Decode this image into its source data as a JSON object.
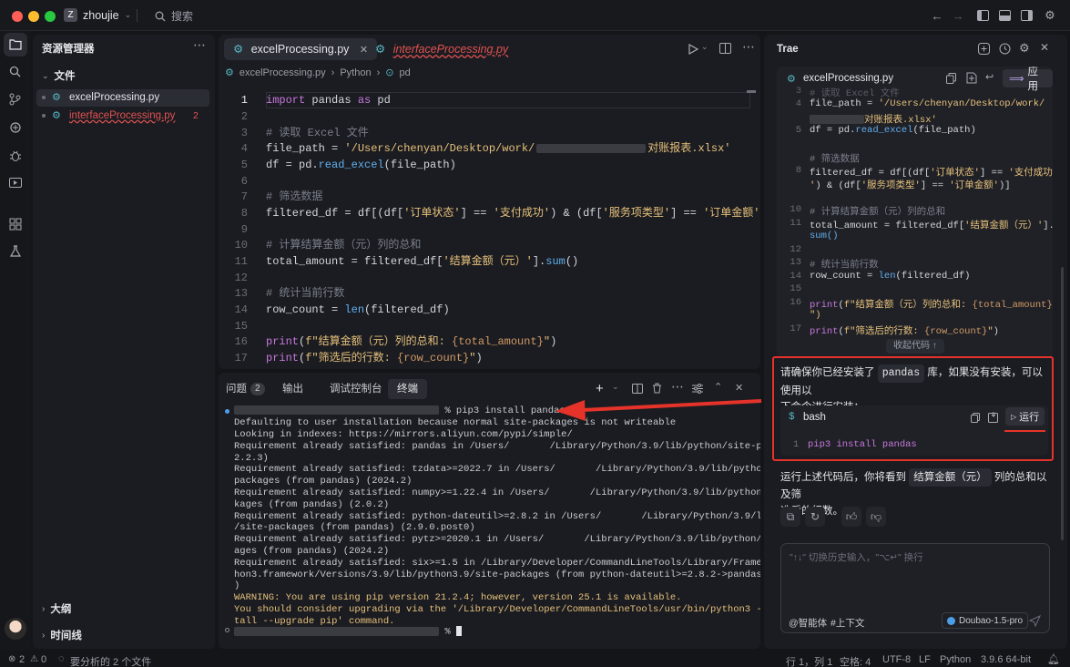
{
  "titlebar": {
    "workspace_initial": "Z",
    "workspace": "zhoujie",
    "search": "搜索"
  },
  "explorer": {
    "title": "资源管理器",
    "section": "文件",
    "files": [
      {
        "name": "excelProcessing.py",
        "badge": ""
      },
      {
        "name": "interfaceProcessing.py",
        "badge": "2"
      }
    ],
    "outline": "大纲",
    "timeline": "时间线"
  },
  "editor": {
    "tabs": [
      "excelProcessing.py",
      "interfaceProcessing.py"
    ],
    "breadcrumb": [
      "excelProcessing.py",
      "Python",
      "pd"
    ],
    "lines": [
      {
        "n": "1",
        "t": "import pandas as pd"
      },
      {
        "n": "2",
        "t": ""
      },
      {
        "n": "3",
        "t": "# 读取 Excel 文件"
      },
      {
        "n": "4",
        "t": "file_path = '/Users/chenyan/Desktop/work/"
      },
      {
        "n": "5",
        "t": "df = pd.read_excel(file_path)"
      },
      {
        "n": "6",
        "t": ""
      },
      {
        "n": "7",
        "t": "# 筛选数据"
      },
      {
        "n": "8",
        "t": "filtered_df = df[(df['订单状态'] == '支付成功') & (df['服务项类型'] == '订单金额')]"
      },
      {
        "n": "9",
        "t": ""
      },
      {
        "n": "10",
        "t": "# 计算结算金额（元）列的总和"
      },
      {
        "n": "11",
        "t": "total_amount = filtered_df['结算金额（元）'].sum()"
      },
      {
        "n": "12",
        "t": ""
      },
      {
        "n": "13",
        "t": "# 统计当前行数"
      },
      {
        "n": "14",
        "t": "row_count = len(filtered_df)"
      },
      {
        "n": "15",
        "t": ""
      },
      {
        "n": "16",
        "t": "print(f\"结算金额（元）列的总和: {total_amount}\")"
      },
      {
        "n": "17",
        "t": "print(f\"筛选后的行数: {row_count}\")"
      }
    ],
    "line4_tail": "对账报表.xlsx'"
  },
  "panel": {
    "tabs": [
      "问题",
      "输出",
      "调试控制台",
      "终端"
    ],
    "problems_count": "2",
    "command": "% pip3 install pandas",
    "output": [
      "Defaulting to user installation because normal site-packages is not writeable",
      "Looking in indexes: https://mirrors.aliyun.com/pypi/simple/",
      "Requirement already satisfied: pandas in /Users/       /Library/Python/3.9/lib/python/site-packages (",
      "2.2.3)",
      "Requirement already satisfied: tzdata>=2022.7 in /Users/       /Library/Python/3.9/lib/python/site-",
      "packages (from pandas) (2024.2)",
      "Requirement already satisfied: numpy>=1.22.4 in /Users/       /Library/Python/3.9/lib/python/site-pac",
      "kages (from pandas) (2.0.2)",
      "Requirement already satisfied: python-dateutil>=2.8.2 in /Users/       /Library/Python/3.9/lib/python3",
      "/site-packages (from pandas) (2.9.0.post0)",
      "Requirement already satisfied: pytz>=2020.1 in /Users/       /Library/Python/3.9/lib/python/site-pack",
      "ages (from pandas) (2024.2)",
      "Requirement already satisfied: six>=1.5 in /Library/Developer/CommandLineTools/Library/Frameworks/Pyt",
      "hon3.framework/Versions/3.9/lib/python3.9/site-packages (from python-dateutil>=2.8.2->pandas) (1.15.0",
      ")"
    ],
    "warnings": [
      "WARNING: You are using pip version 21.2.4; however, version 25.1 is available.",
      "You should consider upgrading via the '/Library/Developer/CommandLineTools/usr/bin/python3 -m pip ins",
      "tall --upgrade pip' command."
    ],
    "prompt_end": "%"
  },
  "trae": {
    "title": "Trae",
    "file": "excelProcessing.py",
    "apply": "应用",
    "code": [
      {
        "n": "3",
        "t": "# 读取 Excel 文件"
      },
      {
        "n": "4",
        "t": "file_path = '/Users/chenyan/Desktop/work/"
      },
      {
        "n": "",
        "t": "对账报表.xlsx'"
      },
      {
        "n": "5",
        "t": "df = pd.read_excel(file_path)"
      },
      {
        "n": "",
        "t": ""
      },
      {
        "n": "",
        "t": "# 筛选数据"
      },
      {
        "n": "8",
        "t": "filtered_df = df[(df['订单状态'] == '支付成功"
      },
      {
        "n": "",
        "t": "') & (df['服务项类型'] == '订单金额')]"
      },
      {
        "n": "",
        "t": ""
      },
      {
        "n": "10",
        "t": "# 计算结算金额（元）列的总和"
      },
      {
        "n": "11",
        "t": "total_amount = filtered_df['结算金额（元）']."
      },
      {
        "n": "",
        "t": "sum()"
      },
      {
        "n": "12",
        "t": ""
      },
      {
        "n": "13",
        "t": "# 统计当前行数"
      },
      {
        "n": "14",
        "t": "row_count = len(filtered_df)"
      },
      {
        "n": "15",
        "t": ""
      },
      {
        "n": "16",
        "t": "print(f\"结算金额（元）列的总和: {total_amount}"
      },
      {
        "n": "",
        "t": "\")"
      },
      {
        "n": "17",
        "t": "print(f\"筛选后的行数: {row_count}\")"
      }
    ],
    "collapse": "收起代码 ↑",
    "msg1_a": "请确保你已经安装了",
    "msg1_chip": "pandas",
    "msg1_b": "库，如果没有安装，可以使用以",
    "msg1_c": "下命令进行安装：",
    "bash_label": "bash",
    "run": "运行",
    "bash_line_no": "1",
    "bash_cmd": "pip3 install pandas",
    "msg2_a": "运行上述代码后，你将看到",
    "msg2_chip": "结算金额（元）",
    "msg2_b": "列的总和以及筛",
    "msg2_c": "选后的行数。",
    "input_placeholder": "\"↑↓\" 切换历史输入，\"⌥↵\" 换行",
    "agent": "@智能体",
    "context": "#上下文",
    "model": "Doubao-1.5-pro"
  },
  "status": {
    "errors": "2",
    "warnings": "0",
    "analyze": "要分析的 2 个文件",
    "position": "行 1，列 1",
    "spaces": "空格: 4",
    "encoding": "UTF-8",
    "eol": "LF",
    "language": "Python",
    "interpreter": "3.9.6 64-bit"
  },
  "colors": {
    "accent_red": "#e5332a",
    "error": "#e05252",
    "purple": "#c678dd",
    "teal": "#56b6c2"
  }
}
